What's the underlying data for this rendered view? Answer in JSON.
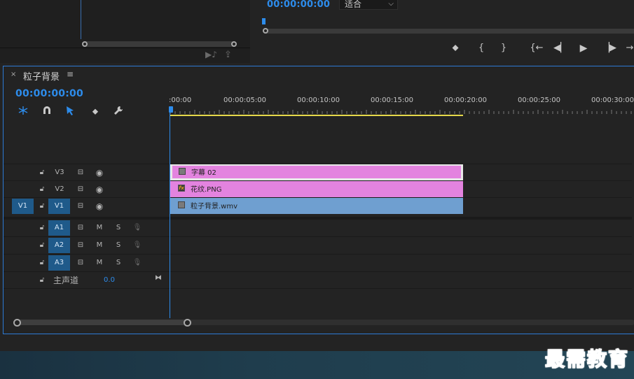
{
  "program": {
    "timecode": "00:00:00:00",
    "fit_select": "适合"
  },
  "transport": {
    "marker": "⬥",
    "in": "{",
    "out": "}",
    "goto_in": "{←",
    "step_back": "◀▏",
    "play": "▶",
    "step_fwd": "▕▶",
    "more": "→"
  },
  "sequence": {
    "close": "×",
    "title": "粒子背景",
    "menu": "≡",
    "timecode": "00:00:00:00"
  },
  "ruler": {
    "labels": [
      ":00:00",
      "00:00:05:00",
      "00:00:10:00",
      "00:00:15:00",
      "00:00:20:00",
      "00:00:25:00",
      "00:00:30:00"
    ]
  },
  "tracks": {
    "v3": {
      "name": "V3",
      "clip": "字幕 02"
    },
    "v2": {
      "name": "V2",
      "clip": "花纹.PNG",
      "fx": "fx"
    },
    "v1": {
      "target": "V1",
      "name": "V1",
      "clip": "粒子背景.wmv"
    },
    "a1": {
      "name": "A1",
      "m": "M",
      "s": "S"
    },
    "a2": {
      "name": "A2",
      "m": "M",
      "s": "S"
    },
    "a3": {
      "name": "A3",
      "m": "M",
      "s": "S"
    },
    "master": {
      "name": "主声道",
      "value": "0.0"
    }
  },
  "watermark": "最需教育",
  "colors": {
    "accent": "#2d8ceb",
    "clip_pink": "#e383df",
    "clip_blue": "#6f9fd0",
    "workarea": "#e6d94a"
  }
}
